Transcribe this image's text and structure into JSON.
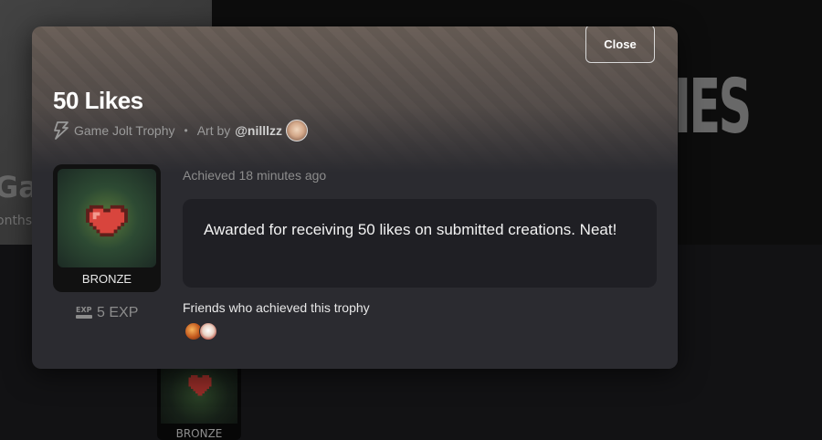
{
  "background": {
    "big_text": "IES",
    "partial_title": "Ga",
    "partial_subtitle": "onths",
    "card_label": "BRONZE"
  },
  "modal": {
    "close_label": "Close",
    "title": "50 Likes",
    "source": "Game Jolt Trophy",
    "separator": "•",
    "art_by_label": "Art by",
    "artist_handle": "@nilllzz",
    "trophy_tier": "BRONZE",
    "exp_badge": "EXP",
    "exp_value": "5 EXP",
    "achieved_text": "Achieved 18 minutes ago",
    "description": "Awarded for receiving 50 likes on submitted creations. Neat!",
    "friends_label": "Friends who achieved this trophy"
  },
  "icons": {
    "trophy_type": "bolt-icon",
    "trophy_art": "pixel-heart-icon",
    "exp": "exp-icon"
  },
  "colors": {
    "modal_bg": "#2b2b30",
    "desc_bg": "#1f1f24",
    "heart": "#d8453d"
  }
}
